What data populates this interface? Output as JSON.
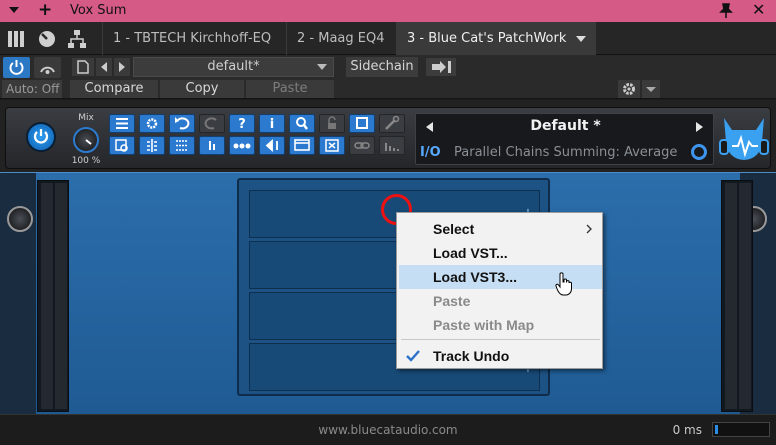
{
  "window": {
    "title": "Vox Sum"
  },
  "tabs": [
    {
      "label": "1 - TBTECH Kirchhoff-EQ"
    },
    {
      "label": "2 - Maag EQ4"
    },
    {
      "label": "3 - Blue Cat's PatchWork"
    }
  ],
  "toolbar": {
    "preset": "default*",
    "sidechain": "Sidechain",
    "auto": "Auto: Off",
    "compare": "Compare",
    "copy": "Copy",
    "paste": "Paste"
  },
  "plugin": {
    "mix_label": "Mix",
    "mix_value": "100 %",
    "preset_name": "Default *",
    "io_label": "I/O",
    "routing": "Parallel Chains Summing: Average",
    "url": "www.bluecataudio.com",
    "latency": "0 ms"
  },
  "context_menu": {
    "items": [
      {
        "label": "Select",
        "enabled": true,
        "submenu": true
      },
      {
        "label": "Load VST...",
        "enabled": true
      },
      {
        "label": "Load VST3...",
        "enabled": true,
        "hovered": true
      },
      {
        "label": "Paste",
        "enabled": false
      },
      {
        "label": "Paste with Map",
        "enabled": false
      },
      {
        "label": "Track Undo",
        "enabled": true,
        "checked": true
      }
    ]
  },
  "colors": {
    "titlebar": "#d65a86",
    "accent_blue": "#2b78c4",
    "panel_blue": "#2b6eab",
    "highlight_circle": "#e11111",
    "menu_hover": "#c6def3"
  }
}
